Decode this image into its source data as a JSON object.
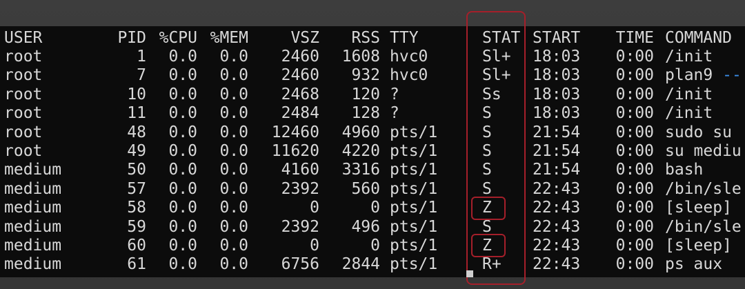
{
  "columns": [
    "USER",
    "PID",
    "%CPU",
    "%MEM",
    "VSZ",
    "RSS",
    "TTY",
    "STAT",
    "START",
    "TIME",
    "COMMAND"
  ],
  "rows": [
    {
      "user": "root",
      "pid": "1",
      "cpu": "0.0",
      "mem": "0.0",
      "vsz": "2460",
      "rss": "1608",
      "tty": "hvc0",
      "stat": "Sl+",
      "start": "18:03",
      "time": "0:00",
      "command": "/init"
    },
    {
      "user": "root",
      "pid": "7",
      "cpu": "0.0",
      "mem": "0.0",
      "vsz": "2460",
      "rss": "932",
      "tty": "hvc0",
      "stat": "Sl+",
      "start": "18:03",
      "time": "0:00",
      "command": "plan9 --"
    },
    {
      "user": "root",
      "pid": "10",
      "cpu": "0.0",
      "mem": "0.0",
      "vsz": "2468",
      "rss": "120",
      "tty": "?",
      "stat": "Ss",
      "start": "18:03",
      "time": "0:00",
      "command": "/init"
    },
    {
      "user": "root",
      "pid": "11",
      "cpu": "0.0",
      "mem": "0.0",
      "vsz": "2484",
      "rss": "128",
      "tty": "?",
      "stat": "S",
      "start": "18:03",
      "time": "0:00",
      "command": "/init"
    },
    {
      "user": "root",
      "pid": "48",
      "cpu": "0.0",
      "mem": "0.0",
      "vsz": "12460",
      "rss": "4960",
      "tty": "pts/1",
      "stat": "S",
      "start": "21:54",
      "time": "0:00",
      "command": "sudo su"
    },
    {
      "user": "root",
      "pid": "49",
      "cpu": "0.0",
      "mem": "0.0",
      "vsz": "11620",
      "rss": "4220",
      "tty": "pts/1",
      "stat": "S",
      "start": "21:54",
      "time": "0:00",
      "command": "su mediu"
    },
    {
      "user": "medium",
      "pid": "50",
      "cpu": "0.0",
      "mem": "0.0",
      "vsz": "4160",
      "rss": "3316",
      "tty": "pts/1",
      "stat": "S",
      "start": "21:54",
      "time": "0:00",
      "command": "bash"
    },
    {
      "user": "medium",
      "pid": "57",
      "cpu": "0.0",
      "mem": "0.0",
      "vsz": "2392",
      "rss": "560",
      "tty": "pts/1",
      "stat": "S",
      "start": "22:43",
      "time": "0:00",
      "command": "/bin/sle"
    },
    {
      "user": "medium",
      "pid": "58",
      "cpu": "0.0",
      "mem": "0.0",
      "vsz": "0",
      "rss": "0",
      "tty": "pts/1",
      "stat": "Z",
      "start": "22:43",
      "time": "0:00",
      "command": "[sleep]"
    },
    {
      "user": "medium",
      "pid": "59",
      "cpu": "0.0",
      "mem": "0.0",
      "vsz": "2392",
      "rss": "496",
      "tty": "pts/1",
      "stat": "S",
      "start": "22:43",
      "time": "0:00",
      "command": "/bin/sle"
    },
    {
      "user": "medium",
      "pid": "60",
      "cpu": "0.0",
      "mem": "0.0",
      "vsz": "0",
      "rss": "0",
      "tty": "pts/1",
      "stat": "Z",
      "start": "22:43",
      "time": "0:00",
      "command": "[sleep]"
    },
    {
      "user": "medium",
      "pid": "61",
      "cpu": "0.0",
      "mem": "0.0",
      "vsz": "6756",
      "rss": "2844",
      "tty": "pts/1",
      "stat": "R+",
      "start": "22:43",
      "time": "0:00",
      "command": "ps aux"
    }
  ],
  "colors": {
    "terminal_bg": "#0c0c0c",
    "text": "#d8d8d8",
    "highlight": "#a51f2a",
    "frame": "#3a3a3a"
  }
}
